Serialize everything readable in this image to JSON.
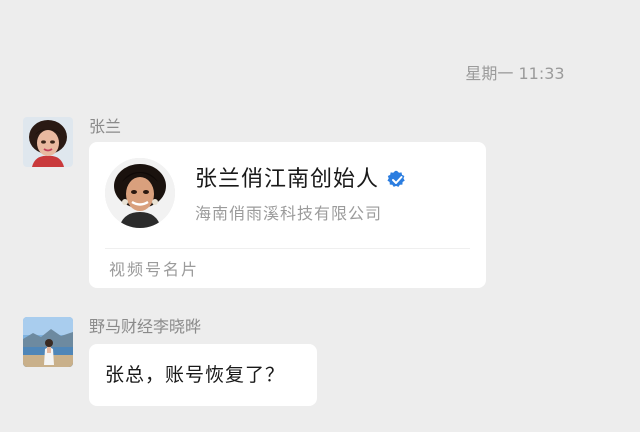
{
  "timestamp": "星期一 11:33",
  "messages": [
    {
      "sender": "张兰",
      "avatar_icon": "woman-portrait-avatar-icon",
      "card": {
        "name": "张兰俏江南创始人",
        "verified_icon": "verified-badge-icon",
        "company": "海南俏雨溪科技有限公司",
        "type_label": "视频号名片"
      }
    },
    {
      "sender": "野马财经李晓晔",
      "avatar_icon": "landscape-photo-avatar-icon",
      "text": "张总，账号恢复了？"
    }
  ],
  "colors": {
    "background": "#ededed",
    "bubble": "#ffffff",
    "verified_blue": "#2b7de0",
    "muted_text": "#9b9b9b"
  }
}
